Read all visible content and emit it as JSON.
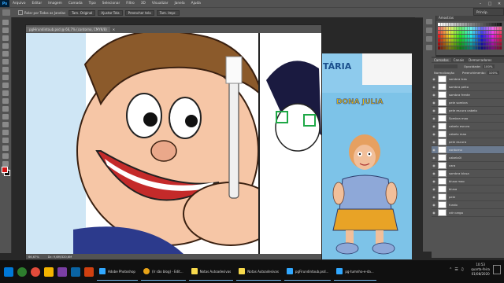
{
  "menubar": {
    "app_icon": "Ps",
    "items": [
      "Arquivo",
      "Editar",
      "Imagem",
      "Camada",
      "Tipo",
      "Selecionar",
      "Filtro",
      "3D",
      "Visualizar",
      "Janela",
      "Ajuda"
    ]
  },
  "optionsbar": {
    "checkbox_label": "Rolar por Todas as Janelas",
    "buttons": [
      "Tam. Original",
      "Ajustar Tela",
      "Preencher tela",
      "Tam. Impr."
    ],
    "workspace": "Princip."
  },
  "document": {
    "tab_title": "pgHirundintoub.psd @ 66,7% (contorno, CMYK/8)",
    "zoom": "66,67%",
    "doc_size": "Dc: 9,6M/320,6M"
  },
  "back_document": {
    "banner_text": "TÁRIA",
    "character_name": "DONA JULIA"
  },
  "panels": {
    "swatches_tabs": [
      "Amostras"
    ],
    "layers_tabs": [
      "Camadas",
      "Canais",
      "Demarcadores"
    ],
    "opacity_label": "Opacidade:",
    "opacity_value": "100%",
    "fill_label": "Preenchimento:",
    "fill_value": "100%",
    "lock_label": "Normalização",
    "layers": [
      "sombra tras",
      "sombra peito",
      "sombra frente",
      "pele sombra",
      "pele escura cabelo",
      "Sombra mao",
      "cabelo escuro",
      "cabelo mao",
      "pele escura",
      "contorno",
      "cabelo0l",
      "cara",
      "sombra blusa",
      "blusa mao",
      "blusa",
      "pele",
      "fundo",
      "cdr cargo"
    ],
    "selected_layer": "contorno"
  },
  "taskbar": {
    "apps": [
      {
        "label": "Adobe Photoshop",
        "color": "#31a8ff"
      },
      {
        "label": "(Ir são blog) - Edit...",
        "color": "#e8a317"
      },
      {
        "label": "Notas Autoadesivas",
        "color": "#f7d94c"
      },
      {
        "label": "Notas Autoadesivas",
        "color": "#f7d94c"
      },
      {
        "label": "pgFirundintoub.psd...",
        "color": "#31a8ff"
      },
      {
        "label": "pg-tumnho-e-da...",
        "color": "#31a8ff"
      }
    ],
    "time": "10:53",
    "day": "quarta-feira",
    "date": "01/08/2020"
  }
}
